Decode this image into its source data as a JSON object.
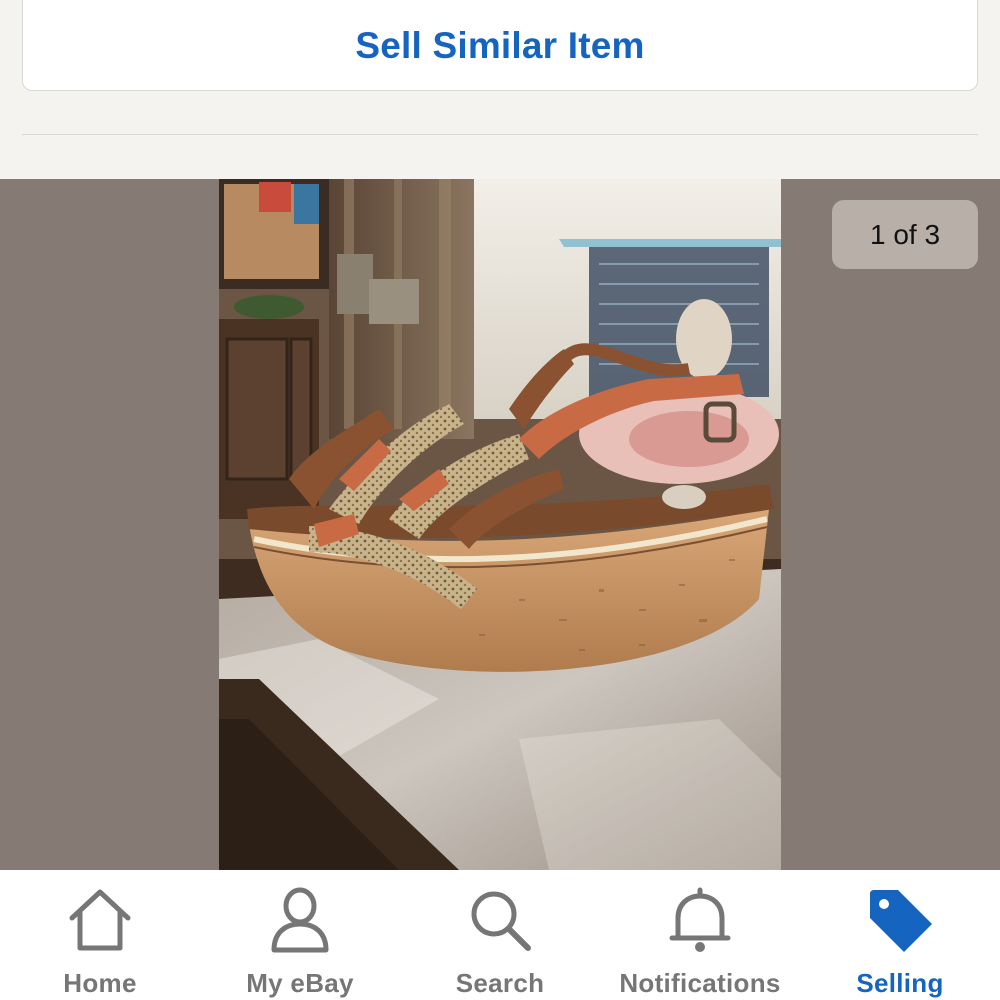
{
  "sell_similar": {
    "label": "Sell Similar Item"
  },
  "gallery": {
    "counter": "1 of 3",
    "current": 1,
    "total": 3
  },
  "tabs": [
    {
      "label": "Home",
      "icon": "home-icon"
    },
    {
      "label": "My eBay",
      "icon": "user-icon"
    },
    {
      "label": "Search",
      "icon": "search-icon"
    },
    {
      "label": "Notifications",
      "icon": "bell-icon"
    },
    {
      "label": "Selling",
      "icon": "price-tag-icon",
      "active": true
    }
  ],
  "colors": {
    "accent": "#1565c0",
    "inactive": "#767676",
    "gallery_bg": "#857b74"
  }
}
